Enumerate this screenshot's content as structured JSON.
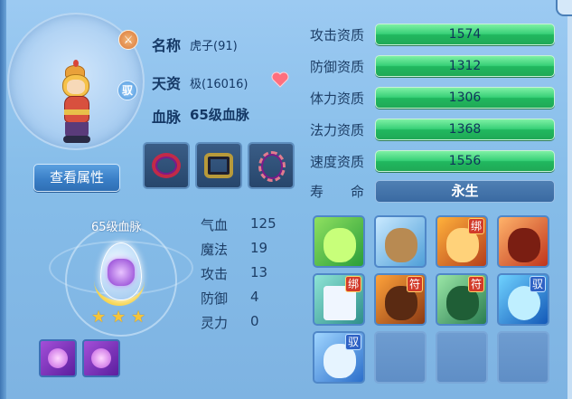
{
  "pet": {
    "name_label": "名称",
    "name_value": "虎子(91)",
    "talent_label": "天资",
    "talent_value": "极(16016)",
    "lineage_label": "血脉",
    "lineage_value": "65级血脉",
    "badge_tame": "驭",
    "view_attr_button": "查看属性"
  },
  "aptitudes": [
    {
      "label": "攻击资质",
      "value": "1574"
    },
    {
      "label": "防御资质",
      "value": "1312"
    },
    {
      "label": "体力资质",
      "value": "1306"
    },
    {
      "label": "法力资质",
      "value": "1368"
    },
    {
      "label": "速度资质",
      "value": "1556"
    }
  ],
  "lifespan": {
    "label": "寿　　命",
    "value": "永生"
  },
  "lineage_orb": {
    "title": "65级血脉",
    "stars": 3
  },
  "bonuses": [
    {
      "label": "气血",
      "value": "125"
    },
    {
      "label": "魔法",
      "value": "19"
    },
    {
      "label": "攻击",
      "value": "13"
    },
    {
      "label": "防御",
      "value": "4"
    },
    {
      "label": "灵力",
      "value": "0"
    }
  ],
  "skills": [
    {
      "icon": "green-ghost-skill-icon",
      "tag": ""
    },
    {
      "icon": "boot-skill-icon",
      "tag": ""
    },
    {
      "icon": "fire-dancer-skill-icon",
      "tag": "绑"
    },
    {
      "icon": "red-warrior-skill-icon",
      "tag": ""
    },
    {
      "icon": "sword-slash-skill-icon",
      "tag": "绑"
    },
    {
      "icon": "golem-skill-icon",
      "tag": "符"
    },
    {
      "icon": "green-figure-skill-icon",
      "tag": "符"
    },
    {
      "icon": "water-orb-skill-icon",
      "tag": "驭"
    },
    {
      "icon": "fist-skill-icon",
      "tag": "驭"
    }
  ],
  "colors": {
    "bar_green": "#37d077",
    "life_bar": "#3a6aa2",
    "badge_red": "#d23b2a",
    "badge_blue": "#2f62c5"
  }
}
